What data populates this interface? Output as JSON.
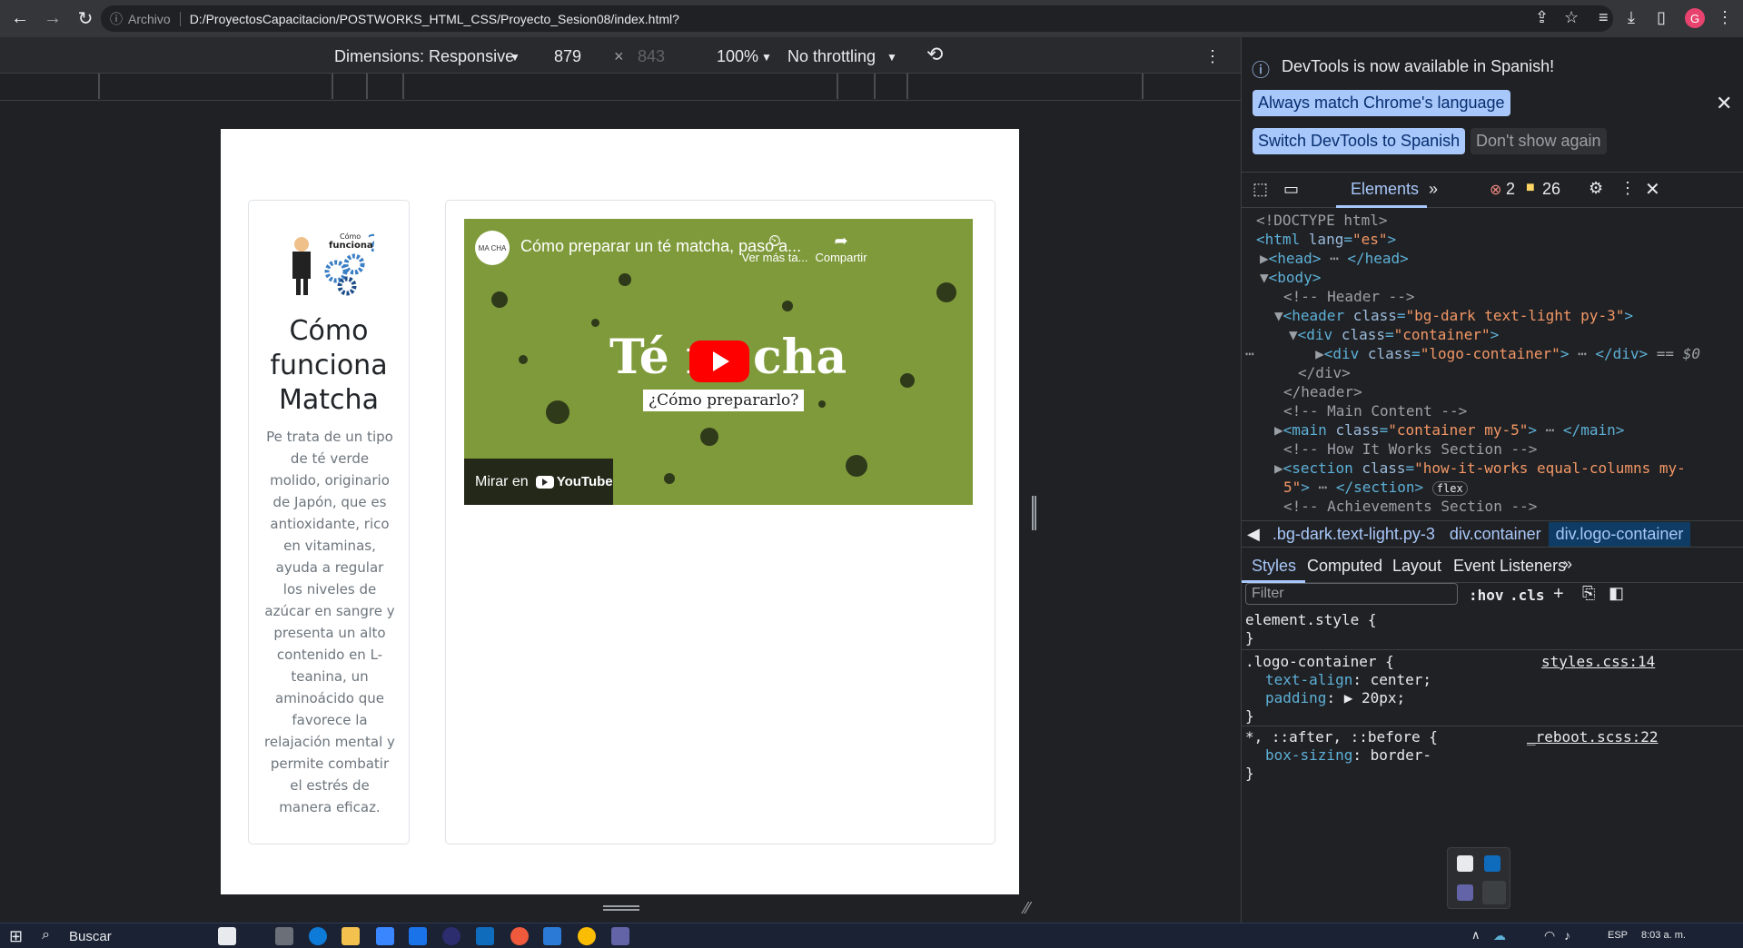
{
  "browser": {
    "scheme_label": "Archivo",
    "url": "D:/ProyectosCapacitacion/POSTWORKS_HTML_CSS/Proyecto_Sesion08/index.html?",
    "profile_initial": "G"
  },
  "device_toolbar": {
    "dimensions_label": "Dimensions: Responsive",
    "width": "879",
    "times": "×",
    "height": "843",
    "zoom": "100%",
    "throttling": "No throttling"
  },
  "page": {
    "logo_small_text_1": "Cómo",
    "logo_small_text_2": "funciona",
    "logo_q": "?",
    "title": "Cómo funciona Matcha",
    "description": "Pe trata de un tipo de té verde molido, originario de Japón, que es antioxidante, rico en vitaminas, ayuda a regular los niveles de azúcar en sangre y presenta un alto contenido en L-teanina, un aminoácido que favorece la relajación mental y permite combatir el estrés de manera eficaz.",
    "video": {
      "channel_badge": "MA CHA",
      "title": "Cómo preparar un té matcha, paso a...",
      "watch_later": "Ver más ta...",
      "share": "Compartir",
      "big_text_left": "Té r",
      "big_text_right": "cha",
      "subtitle": "¿Cómo prepararlo?",
      "watch_on": "Mirar en",
      "youtube": "YouTube"
    }
  },
  "devtools": {
    "banner": "DevTools is now available in Spanish!",
    "btn_always": "Always match Chrome's language",
    "btn_switch": "Switch DevTools to Spanish",
    "btn_dont": "Don't show again",
    "tab_elements": "Elements",
    "errors": "2",
    "warnings": "26",
    "dom": {
      "doctype": "<!DOCTYPE html>",
      "html_open": "<html ",
      "html_attr": "lang",
      "html_val": "\"es\"",
      "head": "<head>",
      "head_close": "</head>",
      "body": "<body>",
      "comment_header": "<!-- Header -->",
      "header_tag": "<header ",
      "header_attr": "class",
      "header_val": "\"bg-dark text-light py-3\"",
      "div_container": "<div ",
      "div_container_val": "\"container\"",
      "div_logo": "<div ",
      "div_logo_val": "\"logo-container\"",
      "div_logo_close": "</div>",
      "eq_dollar": "== $0",
      "div_close": "</div>",
      "header_close": "</header>",
      "comment_main": "<!-- Main Content -->",
      "main_tag": "<main ",
      "main_val": "\"container my-5\"",
      "main_close": "</main>",
      "comment_how": "<!-- How It Works Section -->",
      "section_tag": "<section ",
      "section_val": "\"how-it-works equal-columns my-",
      "section_val2": "5\"",
      "section_close": "</section>",
      "flex_badge": "flex",
      "comment_ach": "<!-- Achievements Section -->"
    },
    "breadcrumbs": [
      ".bg-dark.text-light.py-3",
      "div.container",
      "div.logo-container"
    ],
    "subtabs": [
      "Styles",
      "Computed",
      "Layout",
      "Event Listeners"
    ],
    "filter_placeholder": "Filter",
    "hov": ":hov",
    "cls": ".cls",
    "styles": {
      "element_style": "element.style {",
      "close_brace": "}",
      "rule1_selector": ".logo-container {",
      "rule1_source": "styles.css:14",
      "rule1_prop1": "text-align",
      "rule1_val1": "center;",
      "rule1_prop2": "padding",
      "rule1_val2": "20px;",
      "rule2_selector": "*, ::after, ::before {",
      "rule2_source": "_reboot.scss:22",
      "rule2_prop1": "box-sizing",
      "rule2_val1": "border-"
    }
  },
  "taskbar": {
    "search": "Buscar",
    "lang": "ESP",
    "time": "8:03 a. m."
  }
}
